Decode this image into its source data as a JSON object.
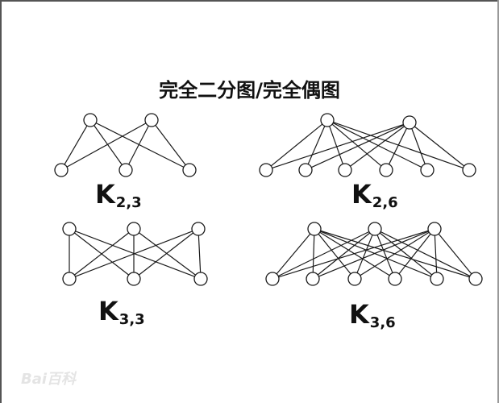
{
  "title": "完全二分图/完全偶图",
  "graphs": [
    {
      "label": "K",
      "subscript": "2,3",
      "top_count": 2,
      "bottom_count": 3
    },
    {
      "label": "K",
      "subscript": "2,6",
      "top_count": 2,
      "bottom_count": 6
    },
    {
      "label": "K",
      "subscript": "3,3",
      "top_count": 3,
      "bottom_count": 3
    },
    {
      "label": "K",
      "subscript": "3,6",
      "top_count": 3,
      "bottom_count": 6
    }
  ],
  "watermark": "Bai百科"
}
